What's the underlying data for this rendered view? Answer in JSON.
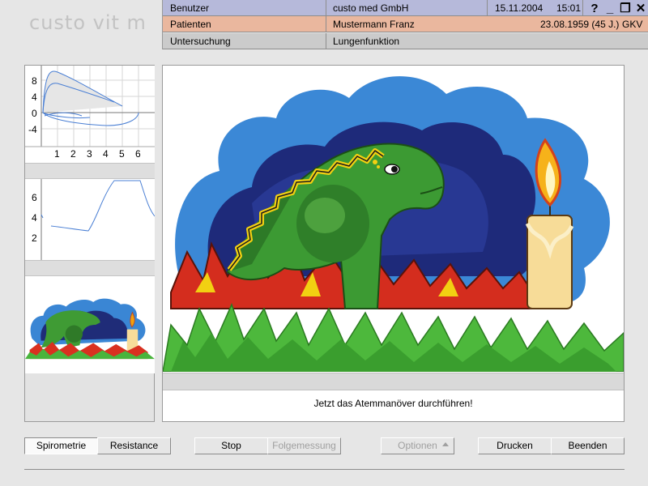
{
  "app": {
    "logo": "custo vit m"
  },
  "header": {
    "user_label": "Benutzer",
    "user_value": "custo med GmbH",
    "date": "15.11.2004",
    "time": "15:01",
    "patient_label": "Patienten",
    "patient_name": "Mustermann Franz",
    "patient_info": "23.08.1959 (45 J.)",
    "insurance": "GKV",
    "exam_label": "Untersuchung",
    "exam_value": "Lungenfunktion"
  },
  "window_buttons": {
    "help": "?",
    "minimize": "_",
    "restore": "❐",
    "close": "✕"
  },
  "chart_flow_volume": {
    "y_ticks": [
      "8",
      "4",
      "0",
      "-4"
    ],
    "x_ticks": [
      "1",
      "2",
      "3",
      "4",
      "5",
      "6"
    ]
  },
  "chart_volume_time": {
    "y_ticks": [
      "6",
      "4",
      "2"
    ]
  },
  "main": {
    "message": "Jetzt das Atemmanöver durchführen!"
  },
  "buttons": {
    "spirometrie": "Spirometrie",
    "resistance": "Resistance",
    "stop": "Stop",
    "folgemessung": "Folgemessung",
    "optionen": "Optionen",
    "drucken": "Drucken",
    "beenden": "Beenden"
  },
  "colors": {
    "user_row": "#b6b9da",
    "patient_row": "#eab79e",
    "exam_row": "#cbcbcb",
    "curve": "#4a7fd4"
  }
}
